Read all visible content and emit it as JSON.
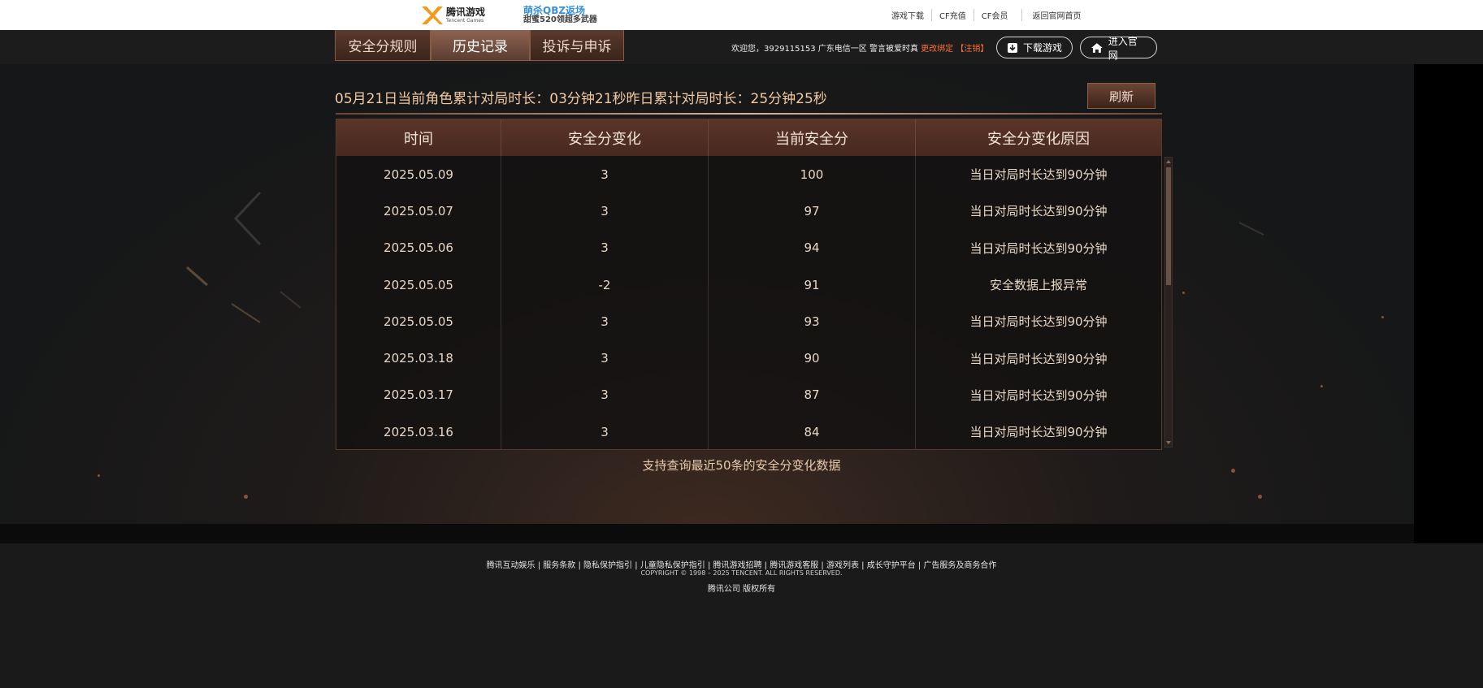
{
  "topbar": {
    "tencent_logo_main": "腾讯游戏",
    "tencent_logo_sub": "Tencent Games",
    "promo_line1": "萌杀QBZ返场",
    "promo_line2": "甜蜜520领超多武器",
    "links": [
      "游戏下载",
      "CF充值",
      "CF会员"
    ],
    "home_link": "返回官网首页"
  },
  "nav": {
    "tabs": [
      "安全分规则",
      "历史记录",
      "投诉与申诉"
    ],
    "active_tab": "历史记录",
    "welcome": "欢迎您，3929115153 广东电信一区 警言被爱时真",
    "change_bind": "更改绑定",
    "logout": "【注销】",
    "download_button": "下载游戏",
    "official_button": "进入官网"
  },
  "summary": {
    "text1": "05月21日当前角色累计对局时长：",
    "today_duration": "03分钟21秒",
    "text2": "昨日累计对局时长：",
    "yesterday_duration": "25分钟25秒",
    "refresh_button": "刷新"
  },
  "table": {
    "headers": [
      "时间",
      "安全分变化",
      "当前安全分",
      "安全分变化原因"
    ],
    "rows": [
      [
        "2025.05.09",
        "3",
        "100",
        "当日对局时长达到90分钟"
      ],
      [
        "2025.05.07",
        "3",
        "97",
        "当日对局时长达到90分钟"
      ],
      [
        "2025.05.06",
        "3",
        "94",
        "当日对局时长达到90分钟"
      ],
      [
        "2025.05.05",
        "-2",
        "91",
        "安全数据上报异常"
      ],
      [
        "2025.05.05",
        "3",
        "93",
        "当日对局时长达到90分钟"
      ],
      [
        "2025.03.18",
        "3",
        "90",
        "当日对局时长达到90分钟"
      ],
      [
        "2025.03.17",
        "3",
        "87",
        "当日对局时长达到90分钟"
      ],
      [
        "2025.03.16",
        "3",
        "84",
        "当日对局时长达到90分钟"
      ]
    ]
  },
  "note": "支持查询最近50条的安全分变化数据",
  "footer": {
    "links": [
      "腾讯互动娱乐",
      "服务条款",
      "隐私保护指引",
      "儿童隐私保护指引",
      "腾讯游戏招聘",
      "腾讯游戏客服",
      "游戏列表",
      "成长守护平台",
      "广告服务及商务合作"
    ],
    "copyright": "COPYRIGHT © 1998 – 2025 TENCENT. ALL RIGHTS RESERVED.",
    "corp": "腾讯公司 版权所有"
  },
  "colors": {
    "accent": "#f1c9a3",
    "warning": "#ff6e36",
    "tab_active": "#8d6350",
    "header_bg": "#5a3428"
  },
  "icons": {
    "tencent_logo": "tencent-games-logo",
    "cf_logo": "cf-logo",
    "download": "download-icon",
    "home": "home-icon"
  }
}
